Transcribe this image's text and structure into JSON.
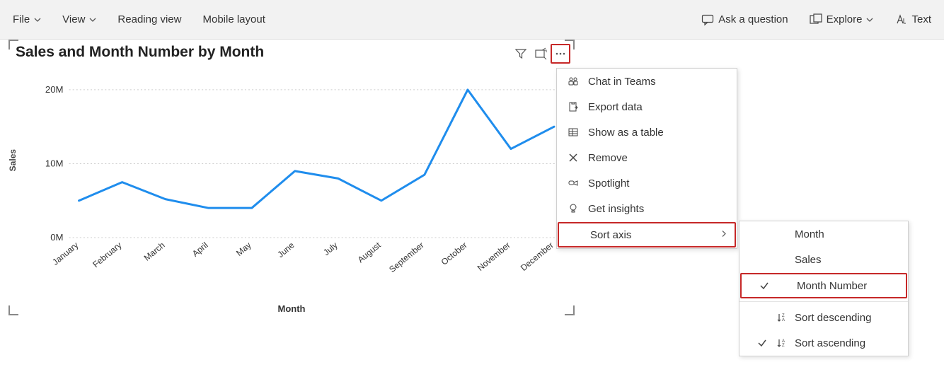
{
  "toolbar": {
    "file": "File",
    "view": "View",
    "reading_view": "Reading view",
    "mobile_layout": "Mobile layout",
    "ask_question": "Ask a question",
    "explore": "Explore",
    "text": "Text"
  },
  "chart": {
    "title": "Sales and Month Number by Month",
    "ylabel": "Sales",
    "xlabel": "Month"
  },
  "chart_data": {
    "type": "line",
    "title": "Sales and Month Number by Month",
    "xlabel": "Month",
    "ylabel": "Sales",
    "categories": [
      "January",
      "February",
      "March",
      "April",
      "May",
      "June",
      "July",
      "August",
      "September",
      "October",
      "November",
      "December"
    ],
    "values": [
      5,
      7.5,
      5.2,
      4,
      4,
      9,
      8,
      5,
      8.5,
      20,
      12,
      15
    ],
    "y_ticks": [
      0,
      10,
      20
    ],
    "y_tick_labels": [
      "0M",
      "10M",
      "20M"
    ],
    "ylim": [
      0,
      22
    ]
  },
  "context_menu": {
    "items": [
      {
        "label": "Chat in Teams",
        "icon": "teams"
      },
      {
        "label": "Export data",
        "icon": "export"
      },
      {
        "label": "Show as a table",
        "icon": "table"
      },
      {
        "label": "Remove",
        "icon": "remove"
      },
      {
        "label": "Spotlight",
        "icon": "spotlight"
      },
      {
        "label": "Get insights",
        "icon": "insights"
      },
      {
        "label": "Sort axis",
        "icon": "",
        "submenu": true
      }
    ]
  },
  "sort_submenu": {
    "options": [
      {
        "label": "Month"
      },
      {
        "label": "Sales"
      },
      {
        "label": "Month Number",
        "checked": true
      }
    ],
    "directions": [
      {
        "label": "Sort descending",
        "icon": "desc"
      },
      {
        "label": "Sort ascending",
        "icon": "asc",
        "checked": true
      }
    ]
  }
}
